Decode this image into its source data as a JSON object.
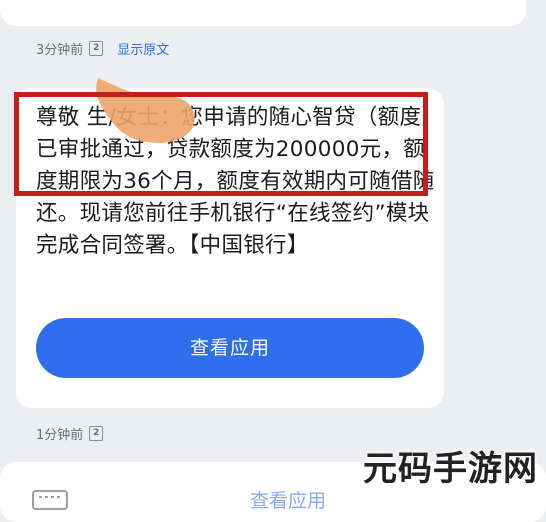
{
  "message": {
    "time": "3分钟前",
    "sim": "2",
    "show_original": "显示原文",
    "body": "尊敬           生/女士：您申请的随心智贷（额度）已审批通过，贷款额度为200000元，额度期限为36个月，额度有效期内可随借随还。现请您前往手机银行“在线签约”模块完成合同签署。【中国银行】",
    "button": "查看应用"
  },
  "next": {
    "time": "1分钟前",
    "sim": "2",
    "button": "查看应用"
  },
  "watermark": "元码手游网",
  "colors": {
    "accent": "#2f6fed",
    "highlight": "#c61d1d",
    "smudge": "#f0a468"
  },
  "icons": [
    "sim-card-icon",
    "keyboard-icon"
  ]
}
